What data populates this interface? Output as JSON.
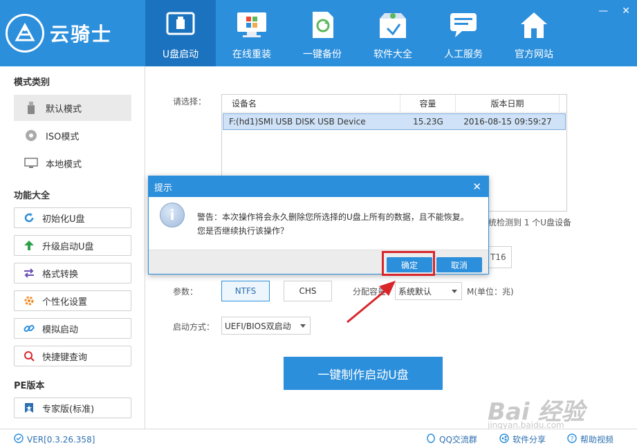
{
  "app": {
    "title": "云骑士"
  },
  "window": {
    "minimize": "—",
    "close": "✕"
  },
  "nav": [
    {
      "label": "U盘启动",
      "icon": "usb-icon"
    },
    {
      "label": "在线重装",
      "icon": "monitor-windows-icon"
    },
    {
      "label": "一键备份",
      "icon": "backup-refresh-icon"
    },
    {
      "label": "软件大全",
      "icon": "software-box-icon"
    },
    {
      "label": "人工服务",
      "icon": "chat-service-icon"
    },
    {
      "label": "官方网站",
      "icon": "home-icon"
    }
  ],
  "sidebar": {
    "mode_title": "模式类别",
    "modes": [
      {
        "label": "默认模式",
        "icon": "usb-drive-icon"
      },
      {
        "label": "ISO模式",
        "icon": "disc-icon"
      },
      {
        "label": "本地模式",
        "icon": "monitor-icon"
      }
    ],
    "func_title": "功能大全",
    "funcs": [
      {
        "label": "初始化U盘",
        "icon": "refresh-icon"
      },
      {
        "label": "升级启动U盘",
        "icon": "arrow-up-icon"
      },
      {
        "label": "格式转换",
        "icon": "swap-arrows-icon"
      },
      {
        "label": "个性化设置",
        "icon": "gear-icon"
      },
      {
        "label": "模拟启动",
        "icon": "link-icon"
      },
      {
        "label": "快捷键查询",
        "icon": "search-icon"
      }
    ],
    "pe_title": "PE版本",
    "pe_option": "专家版(标准)"
  },
  "main": {
    "select_label": "请选择：",
    "columns": [
      "设备名",
      "容量",
      "版本日期"
    ],
    "devices": [
      {
        "name": "F:(hd1)SMI USB DISK USB Device",
        "size": "15.23G",
        "date": "2016-08-15 09:59:27"
      }
    ],
    "detect_text": "统检测到 1 个U盘设备",
    "partial_btn": "T16",
    "params_label": "参数：",
    "param_ntfs": "NTFS",
    "param_chs": "CHS",
    "alloc_label": "分配容量：",
    "alloc_value": "系统默认",
    "unit_label": "M(单位：兆)",
    "boot_label": "启动方式：",
    "boot_value": "UEFI/BIOS双启动",
    "make_button": "一键制作启动U盘"
  },
  "dialog": {
    "title": "提示",
    "line1": "警告：本次操作将会永久删除您所选择的U盘上所有的数据，且不能恢复。",
    "line2": "您是否继续执行该操作？",
    "ok": "确定",
    "cancel": "取消",
    "close": "✕"
  },
  "footer": {
    "version": "VER[0.3.26.358]",
    "qq": "QQ交流群",
    "share": "软件分享",
    "help": "帮助视频"
  },
  "watermark": {
    "brand": "Bai 经验",
    "url": "jingyan.baidu.com"
  }
}
